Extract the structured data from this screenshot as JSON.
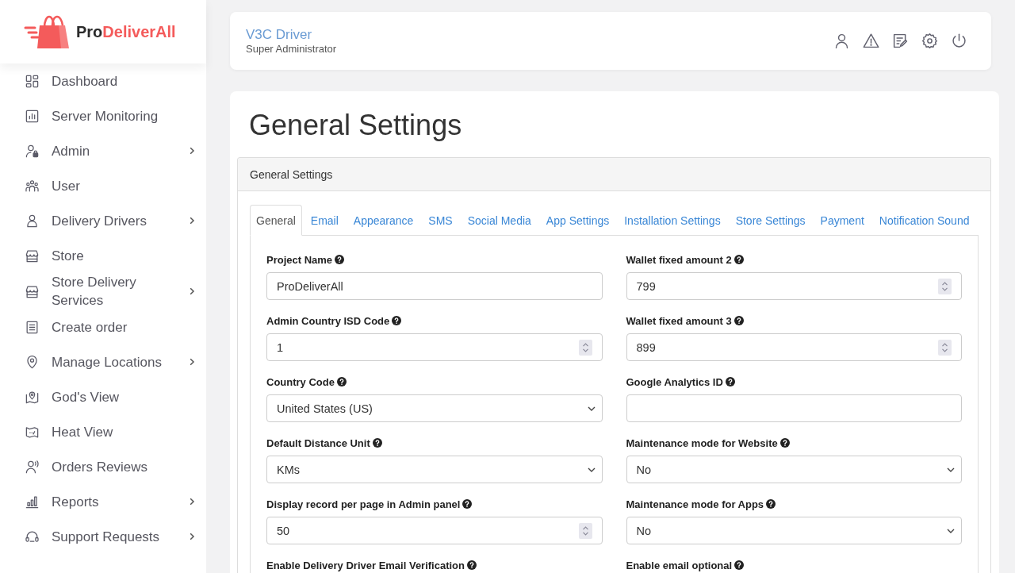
{
  "brand": {
    "prefix": "Pro",
    "name": "DeliverAll"
  },
  "sidebar": {
    "items": [
      {
        "label": "Dashboard",
        "has_submenu": false
      },
      {
        "label": "Server Monitoring",
        "has_submenu": false
      },
      {
        "label": "Admin",
        "has_submenu": true
      },
      {
        "label": "User",
        "has_submenu": false
      },
      {
        "label": "Delivery Drivers",
        "has_submenu": true
      },
      {
        "label": "Store",
        "has_submenu": false
      },
      {
        "label": "Store Delivery Services",
        "has_submenu": true
      },
      {
        "label": "Create order",
        "has_submenu": false
      },
      {
        "label": "Manage Locations",
        "has_submenu": true
      },
      {
        "label": "God's View",
        "has_submenu": false
      },
      {
        "label": "Heat View",
        "has_submenu": false
      },
      {
        "label": "Orders Reviews",
        "has_submenu": false
      },
      {
        "label": "Reports",
        "has_submenu": true
      },
      {
        "label": "Support Requests",
        "has_submenu": true
      }
    ]
  },
  "header": {
    "user_name": "V3C Driver",
    "role": "Super Administrator"
  },
  "page_title": "General Settings",
  "panel": {
    "title": "General Settings",
    "tabs": [
      {
        "label": "General",
        "selected": true
      },
      {
        "label": "Email",
        "selected": false
      },
      {
        "label": "Appearance",
        "selected": false
      },
      {
        "label": "SMS",
        "selected": false
      },
      {
        "label": "Social Media",
        "selected": false
      },
      {
        "label": "App Settings",
        "selected": false
      },
      {
        "label": "Installation Settings",
        "selected": false
      },
      {
        "label": "Store Settings",
        "selected": false
      },
      {
        "label": "Payment",
        "selected": false
      },
      {
        "label": "Notification Sound",
        "selected": false
      }
    ],
    "columns": [
      {
        "fields": [
          {
            "label": "Project Name",
            "kind": "text",
            "value": "ProDeliverAll"
          },
          {
            "label": "Admin Country ISD Code",
            "kind": "number",
            "value": "1"
          },
          {
            "label": "Country Code",
            "kind": "select",
            "value": "United States (US)"
          },
          {
            "label": "Default Distance Unit",
            "kind": "select",
            "value": "KMs"
          },
          {
            "label": "Display record per page in Admin panel",
            "kind": "number",
            "value": "50"
          },
          {
            "label": "Enable Delivery Driver Email Verification"
          }
        ]
      },
      {
        "fields": [
          {
            "label": "Wallet fixed amount 2",
            "kind": "number",
            "value": "799"
          },
          {
            "label": "Wallet fixed amount 3",
            "kind": "number",
            "value": "899"
          },
          {
            "label": "Google Analytics ID",
            "kind": "text"
          },
          {
            "label": "Maintenance mode for Website",
            "kind": "select",
            "value": "No"
          },
          {
            "label": "Maintenance mode for Apps",
            "kind": "select",
            "value": "No"
          },
          {
            "label": "Enable email optional"
          }
        ]
      }
    ]
  }
}
